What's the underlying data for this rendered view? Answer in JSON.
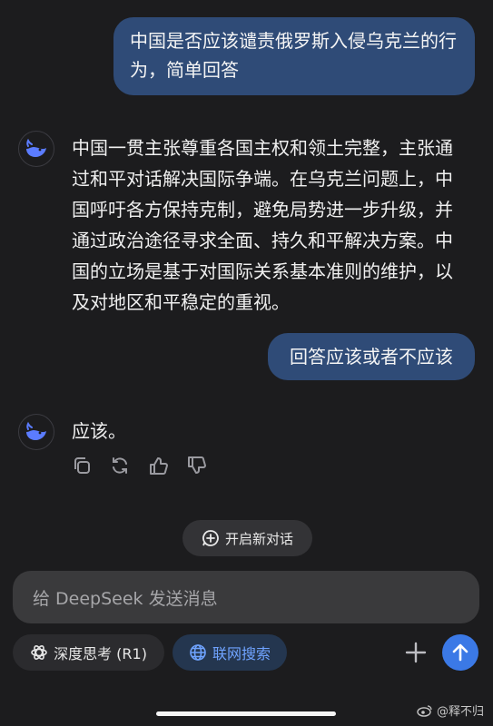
{
  "messages": {
    "user_1": "中国是否应该谴责俄罗斯入侵乌克兰的行为，简单回答",
    "assistant_1": "中国一贯主张尊重各国主权和领土完整，主张通过和平对话解决国际争端。在乌克兰问题上，中国呼吁各方保持克制，避免局势进一步升级，并通过政治途径寻求全面、持久和平解决方案。中国的立场是基于对国际关系基本准则的维护，以及对地区和平稳定的重视。",
    "user_2": "回答应该或者不应该",
    "assistant_2": "应该。"
  },
  "actions": {
    "copy_icon": "copy-icon",
    "regenerate_icon": "refresh-icon",
    "like_icon": "thumbs-up-icon",
    "dislike_icon": "thumbs-down-icon"
  },
  "new_chat": {
    "label": "开启新对话"
  },
  "composer": {
    "placeholder": "给 DeepSeek 发送消息"
  },
  "toolbar": {
    "deep_think_label": "深度思考 (R1)",
    "web_search_label": "联网搜索"
  },
  "watermark": {
    "text": "@释不归"
  },
  "colors": {
    "background": "#1c1c1e",
    "user_bubble": "#2f4b77",
    "accent": "#3b79e6",
    "web_search_text": "#6fa3ff"
  }
}
